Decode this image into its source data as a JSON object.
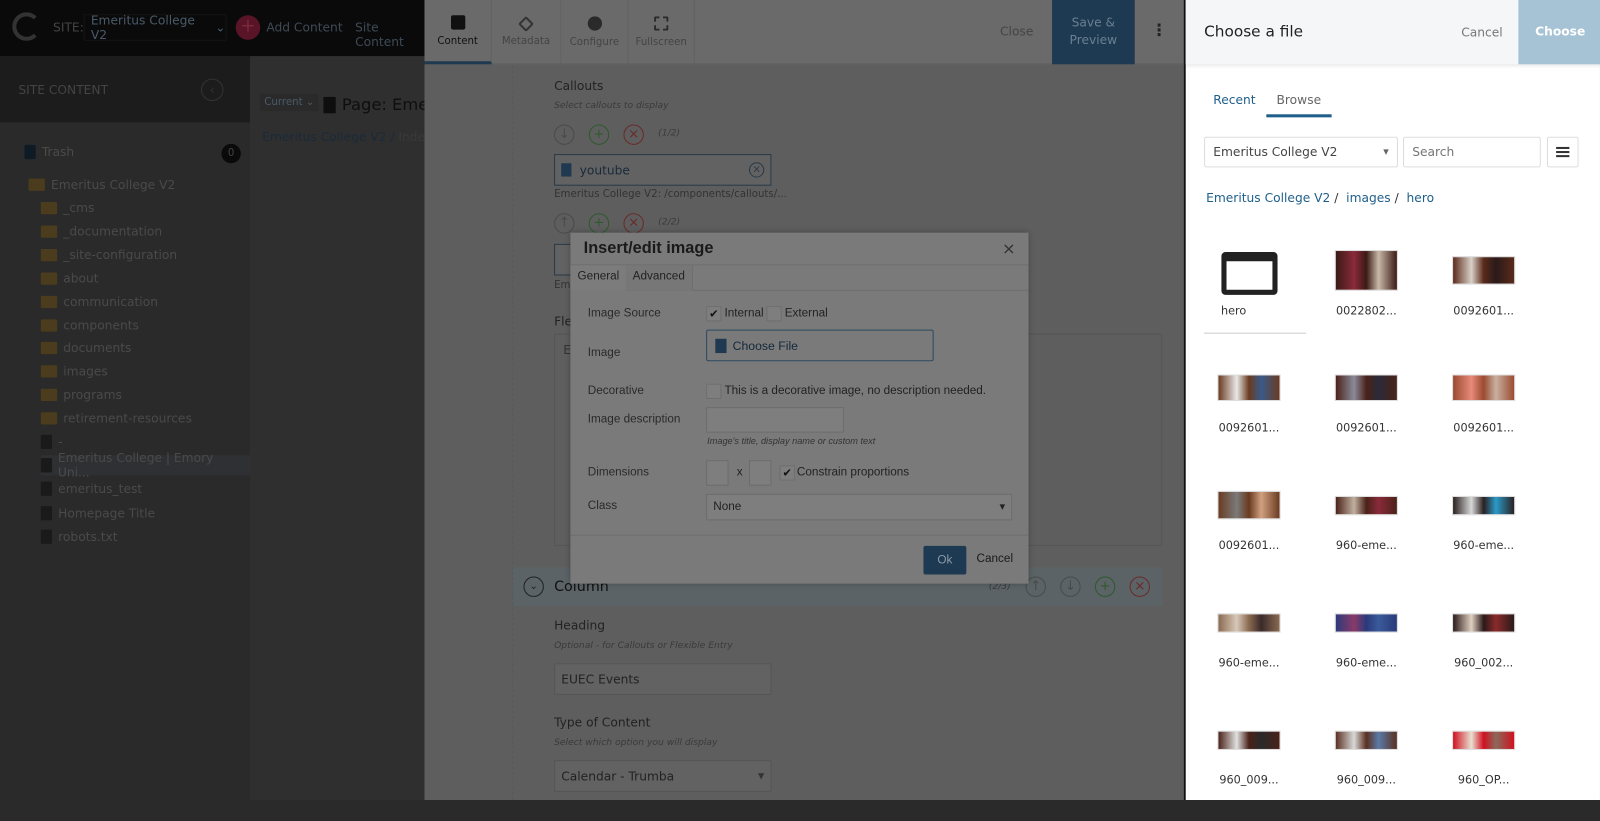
{
  "topbar": {
    "site_label": "SITE:",
    "site_name": "Emeritus College V2",
    "add_content": "Add Content",
    "site_content": "Site Content"
  },
  "sidebar": {
    "title": "SITE CONTENT",
    "trash": "Trash",
    "trash_count": "0",
    "root": "Emeritus College V2",
    "folders": [
      "_cms",
      "_documentation",
      "_site-configuration",
      "about",
      "communication",
      "components",
      "documents",
      "images",
      "programs",
      "retirement-resources"
    ],
    "files": [
      "-",
      "Emeritus College | Emory Uni...",
      "emeritus_test",
      "Homepage Title",
      "robots.txt"
    ]
  },
  "center": {
    "version": "Current",
    "page_title": "Page: Emer",
    "breadcrumb": [
      "Emeritus College V2",
      "Index"
    ]
  },
  "editor": {
    "tabs": [
      {
        "label": "Content",
        "icon": "content-icon"
      },
      {
        "label": "Metadata",
        "icon": "tag-icon"
      },
      {
        "label": "Configure",
        "icon": "gear-icon"
      },
      {
        "label": "Fullscreen",
        "icon": "fullscreen-icon"
      }
    ],
    "close": "Close",
    "save_preview": "Save & Preview",
    "callouts": {
      "label": "Callouts",
      "hint": "Select callouts to display",
      "count1": "(1/2)",
      "item1": "youtube",
      "path1": "Emeritus College V2: /components/callouts/...",
      "count2": "(2/2)",
      "item2_partial": "Emi"
    },
    "flex_partial": "Fle",
    "flex_e": "E",
    "column": {
      "label": "Column",
      "count": "(2/3)",
      "heading_label": "Heading",
      "heading_hint": "Optional - for Callouts or Flexible Entry",
      "heading_value": "EUEC Events",
      "type_label": "Type of Content",
      "type_hint": "Select which option you will display",
      "type_value": "Calendar - Trumba"
    }
  },
  "dialog": {
    "title": "Insert/edit image",
    "tabs": [
      "General",
      "Advanced"
    ],
    "image_source_label": "Image Source",
    "internal": "Internal",
    "internal_checked": true,
    "external": "External",
    "external_checked": false,
    "image_label": "Image",
    "choose_file": "Choose File",
    "decorative_label": "Decorative",
    "decorative_text": "This is a decorative image, no description needed.",
    "decorative_checked": false,
    "description_label": "Image description",
    "description_value": "",
    "description_hint": "Image's title, display name or custom text",
    "dimensions_label": "Dimensions",
    "dim_x": "x",
    "width_value": "",
    "height_value": "",
    "constrain": "Constrain proportions",
    "constrain_checked": true,
    "class_label": "Class",
    "class_value": "None",
    "ok": "Ok",
    "cancel": "Cancel"
  },
  "chooser": {
    "title": "Choose a file",
    "cancel": "Cancel",
    "choose": "Choose",
    "tabs": [
      "Recent",
      "Browse"
    ],
    "active_tab": "Browse",
    "site_select": "Emeritus College V2",
    "search_placeholder": "Search",
    "breadcrumb": [
      "Emeritus College V2",
      "images",
      "hero"
    ],
    "items": [
      {
        "name": "hero",
        "type": "folder"
      },
      {
        "name": "0022802...",
        "type": "image"
      },
      {
        "name": "0092601...",
        "type": "image"
      },
      {
        "name": "0092601...",
        "type": "image"
      },
      {
        "name": "0092601...",
        "type": "image"
      },
      {
        "name": "0092601...",
        "type": "image"
      },
      {
        "name": "0092601...",
        "type": "image"
      },
      {
        "name": "960-eme...",
        "type": "image"
      },
      {
        "name": "960-eme...",
        "type": "image"
      },
      {
        "name": "960-eme...",
        "type": "image"
      },
      {
        "name": "960-eme...",
        "type": "image"
      },
      {
        "name": "960_002...",
        "type": "image"
      },
      {
        "name": "960_009...",
        "type": "image"
      },
      {
        "name": "960_009...",
        "type": "image"
      },
      {
        "name": "960_OP...",
        "type": "image"
      }
    ]
  },
  "colors": {
    "accent": "#1f5f8b",
    "choose_button": "#a6c3d6",
    "save_button": "#1d3a52"
  }
}
